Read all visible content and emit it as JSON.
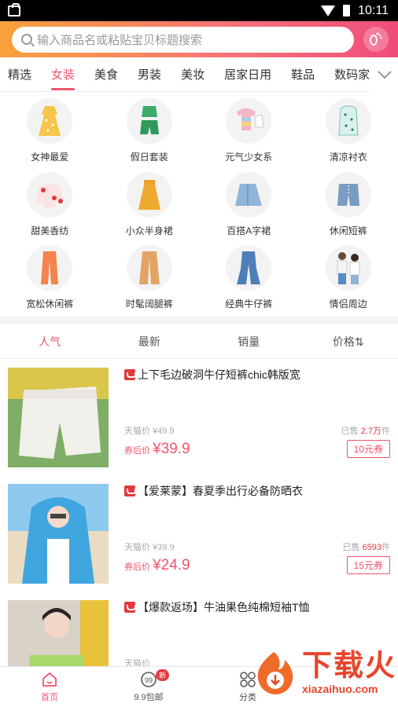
{
  "status_bar": {
    "time": "10:11"
  },
  "search": {
    "placeholder": "输入商品名或粘贴宝贝标题搜索"
  },
  "tabs": [
    {
      "label": "精选"
    },
    {
      "label": "女装"
    },
    {
      "label": "美食"
    },
    {
      "label": "男装"
    },
    {
      "label": "美妆"
    },
    {
      "label": "居家日用"
    },
    {
      "label": "鞋品"
    },
    {
      "label": "数码家电"
    }
  ],
  "categories": [
    {
      "label": "女神最爱"
    },
    {
      "label": "假日套装"
    },
    {
      "label": "元气少女系"
    },
    {
      "label": "清凉衬衣"
    },
    {
      "label": "甜美香纺"
    },
    {
      "label": "小众半身裙"
    },
    {
      "label": "百搭A字裙"
    },
    {
      "label": "休闲短裤"
    },
    {
      "label": "宽松休闲裤"
    },
    {
      "label": "时髦阔腿裤"
    },
    {
      "label": "经典牛仔裤"
    },
    {
      "label": "情侣周边"
    }
  ],
  "sort": [
    {
      "label": "人气"
    },
    {
      "label": "最新"
    },
    {
      "label": "销量"
    },
    {
      "label": "价格⇅"
    }
  ],
  "products": [
    {
      "title": "上下毛边破洞牛仔短裤chic韩版宽",
      "orig_label": "天猫价",
      "orig_price": "¥49.9",
      "sold_prefix": "已售",
      "sold": "2.7万",
      "sold_suffix": "件",
      "after_label": "券后价",
      "price_prefix": "¥",
      "price": "39.9",
      "coupon": "10元券"
    },
    {
      "title": "【爱莱蒙】春夏季出行必备防晒衣",
      "orig_label": "天猫价",
      "orig_price": "¥39.9",
      "sold_prefix": "已售",
      "sold": "6593",
      "sold_suffix": "件",
      "after_label": "券后价",
      "price_prefix": "¥",
      "price": "24.9",
      "coupon": "15元券"
    },
    {
      "title": "【爆款返场】牛油果色纯棉短袖T恤",
      "orig_label": "天猫价",
      "orig_price": "",
      "sold_prefix": "",
      "sold": "",
      "sold_suffix": "",
      "after_label": "",
      "price_prefix": "",
      "price": "",
      "coupon": ""
    }
  ],
  "bottom_nav": [
    {
      "label": "首页"
    },
    {
      "label": "9.9包邮"
    },
    {
      "label": "分类"
    },
    {
      "label": ""
    }
  ],
  "badge": "新",
  "watermark": {
    "cn": "下载火",
    "url": "xiazaihuo.com"
  },
  "colors": {
    "accent": "#f0536c",
    "search_gradient_start": "#f9a13c",
    "search_gradient_end": "#f04d7a"
  }
}
